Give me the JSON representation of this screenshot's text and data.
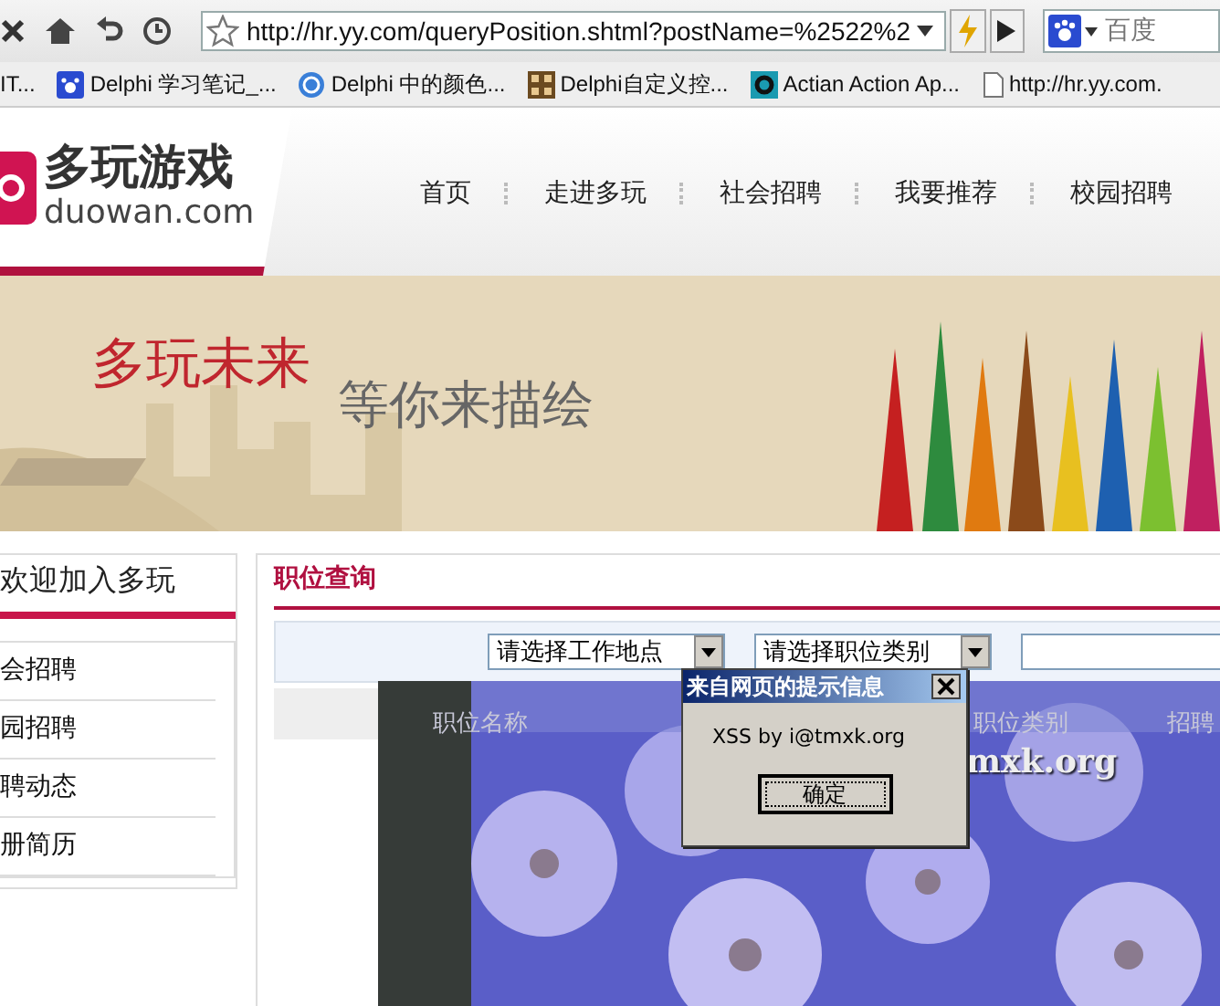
{
  "browser": {
    "address": "http://hr.yy.com/queryPosition.shtml?postName=%2522%2",
    "search_placeholder": "百度"
  },
  "bookmarks": [
    {
      "label": "IT...",
      "kind": "none"
    },
    {
      "label": "Delphi 学习笔记_...",
      "kind": "paw"
    },
    {
      "label": "Delphi 中的颜色...",
      "kind": "globe"
    },
    {
      "label": "Delphi自定义控...",
      "kind": "grid"
    },
    {
      "label": "Actian Action Ap...",
      "kind": "q"
    },
    {
      "label": "http://hr.yy.com.",
      "kind": "page"
    }
  ],
  "site": {
    "logo_text": "多玩游戏",
    "logo_domain": "duowan.com",
    "nav": [
      {
        "label": "首页"
      },
      {
        "label": "走进多玩"
      },
      {
        "label": "社会招聘"
      },
      {
        "label": "我要推荐"
      },
      {
        "label": "校园招聘"
      }
    ],
    "banner": {
      "headline": "多玩未来",
      "tagline": "等你来描绘"
    }
  },
  "sidebar": {
    "title": "欢迎加入多玩",
    "items": [
      {
        "label": "会招聘"
      },
      {
        "label": "园招聘"
      },
      {
        "label": "聘动态"
      },
      {
        "label": "册简历"
      }
    ]
  },
  "search_panel": {
    "title": "职位查询",
    "location_select": "请选择工作地点",
    "category_select": "请选择职位类别"
  },
  "table": {
    "columns": [
      "职位名称",
      "职位类别",
      "招聘"
    ]
  },
  "injected": {
    "kind": "picture",
    "caption": "mxk.org"
  },
  "alert": {
    "title": "来自网页的提示信息",
    "message": "XSS by i@tmxk.org",
    "buttons": [
      "确定"
    ]
  }
}
